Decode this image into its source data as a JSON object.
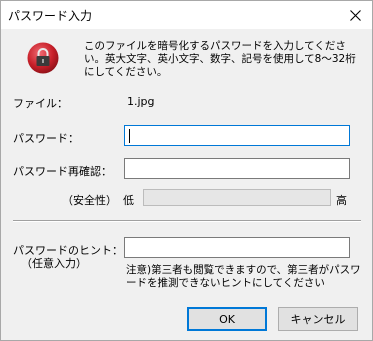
{
  "window": {
    "title": "パスワード入力",
    "close_symbol": "✕"
  },
  "icon": "lock-icon",
  "intro_text": "このファイルを暗号化するパスワードを入力してください。英大文字、英小文字、数字、記号を使用して8～32桁にしてください。",
  "file": {
    "label": "ファイル：",
    "name": "1.jpg"
  },
  "password": {
    "label": "パスワード：",
    "value": ""
  },
  "confirm": {
    "label": "パスワード再確認：",
    "value": ""
  },
  "strength": {
    "label": "（安全性）",
    "low": "低",
    "high": "高",
    "level": 0
  },
  "hint": {
    "label_line1": "パスワードのヒント：",
    "label_line2": "（任意入力）",
    "value": ""
  },
  "note_text": "注意)第三者も閲覧できますので、第三者がパスワードを推測できないヒントにしてください",
  "buttons": {
    "ok": "OK",
    "cancel": "キャンセル"
  },
  "colors": {
    "accent": "#0078d7",
    "lock_red": "#c8202a"
  }
}
